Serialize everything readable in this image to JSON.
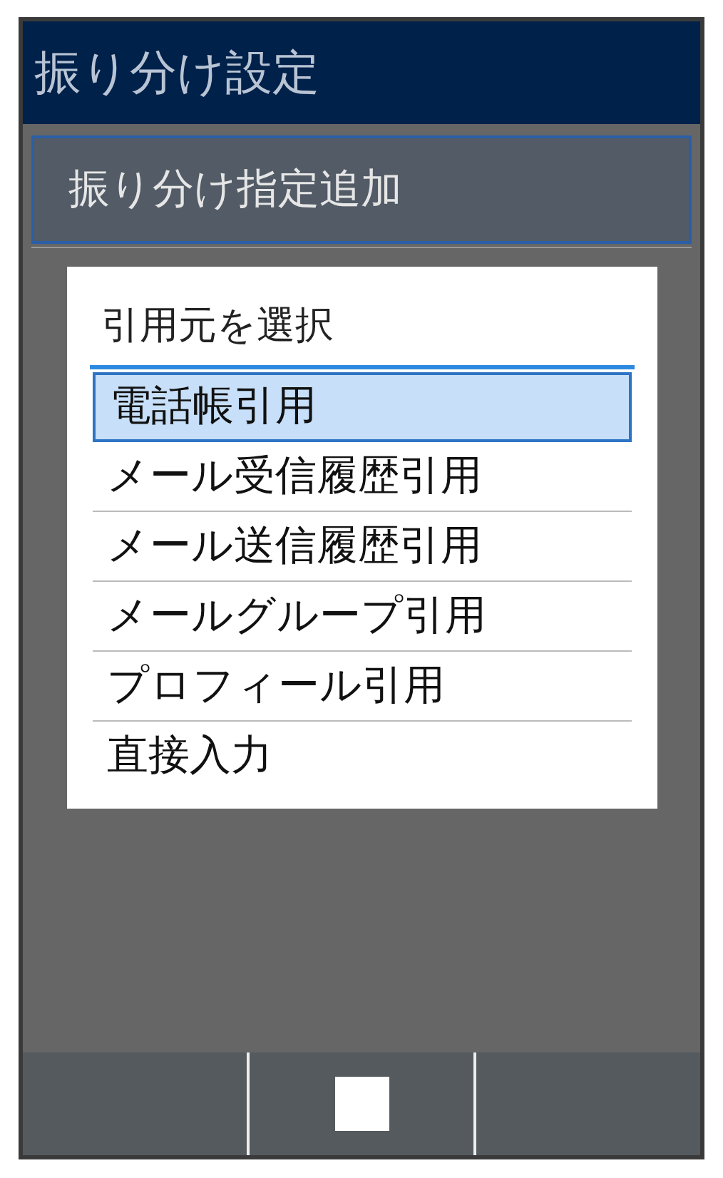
{
  "header": {
    "title": "振り分け設定"
  },
  "list": [
    {
      "label": "振り分け指定追加",
      "selected": true
    }
  ],
  "dialog": {
    "title": "引用元を選択",
    "items": [
      {
        "label": "電話帳引用",
        "selected": true
      },
      {
        "label": "メール受信履歴引用",
        "selected": false
      },
      {
        "label": "メール送信履歴引用",
        "selected": false
      },
      {
        "label": "メールグループ引用",
        "selected": false
      },
      {
        "label": "プロフィール引用",
        "selected": false
      },
      {
        "label": "直接入力",
        "selected": false
      }
    ]
  },
  "softkeys": [
    {
      "kind": "blank"
    },
    {
      "kind": "square"
    },
    {
      "kind": "blank"
    }
  ]
}
